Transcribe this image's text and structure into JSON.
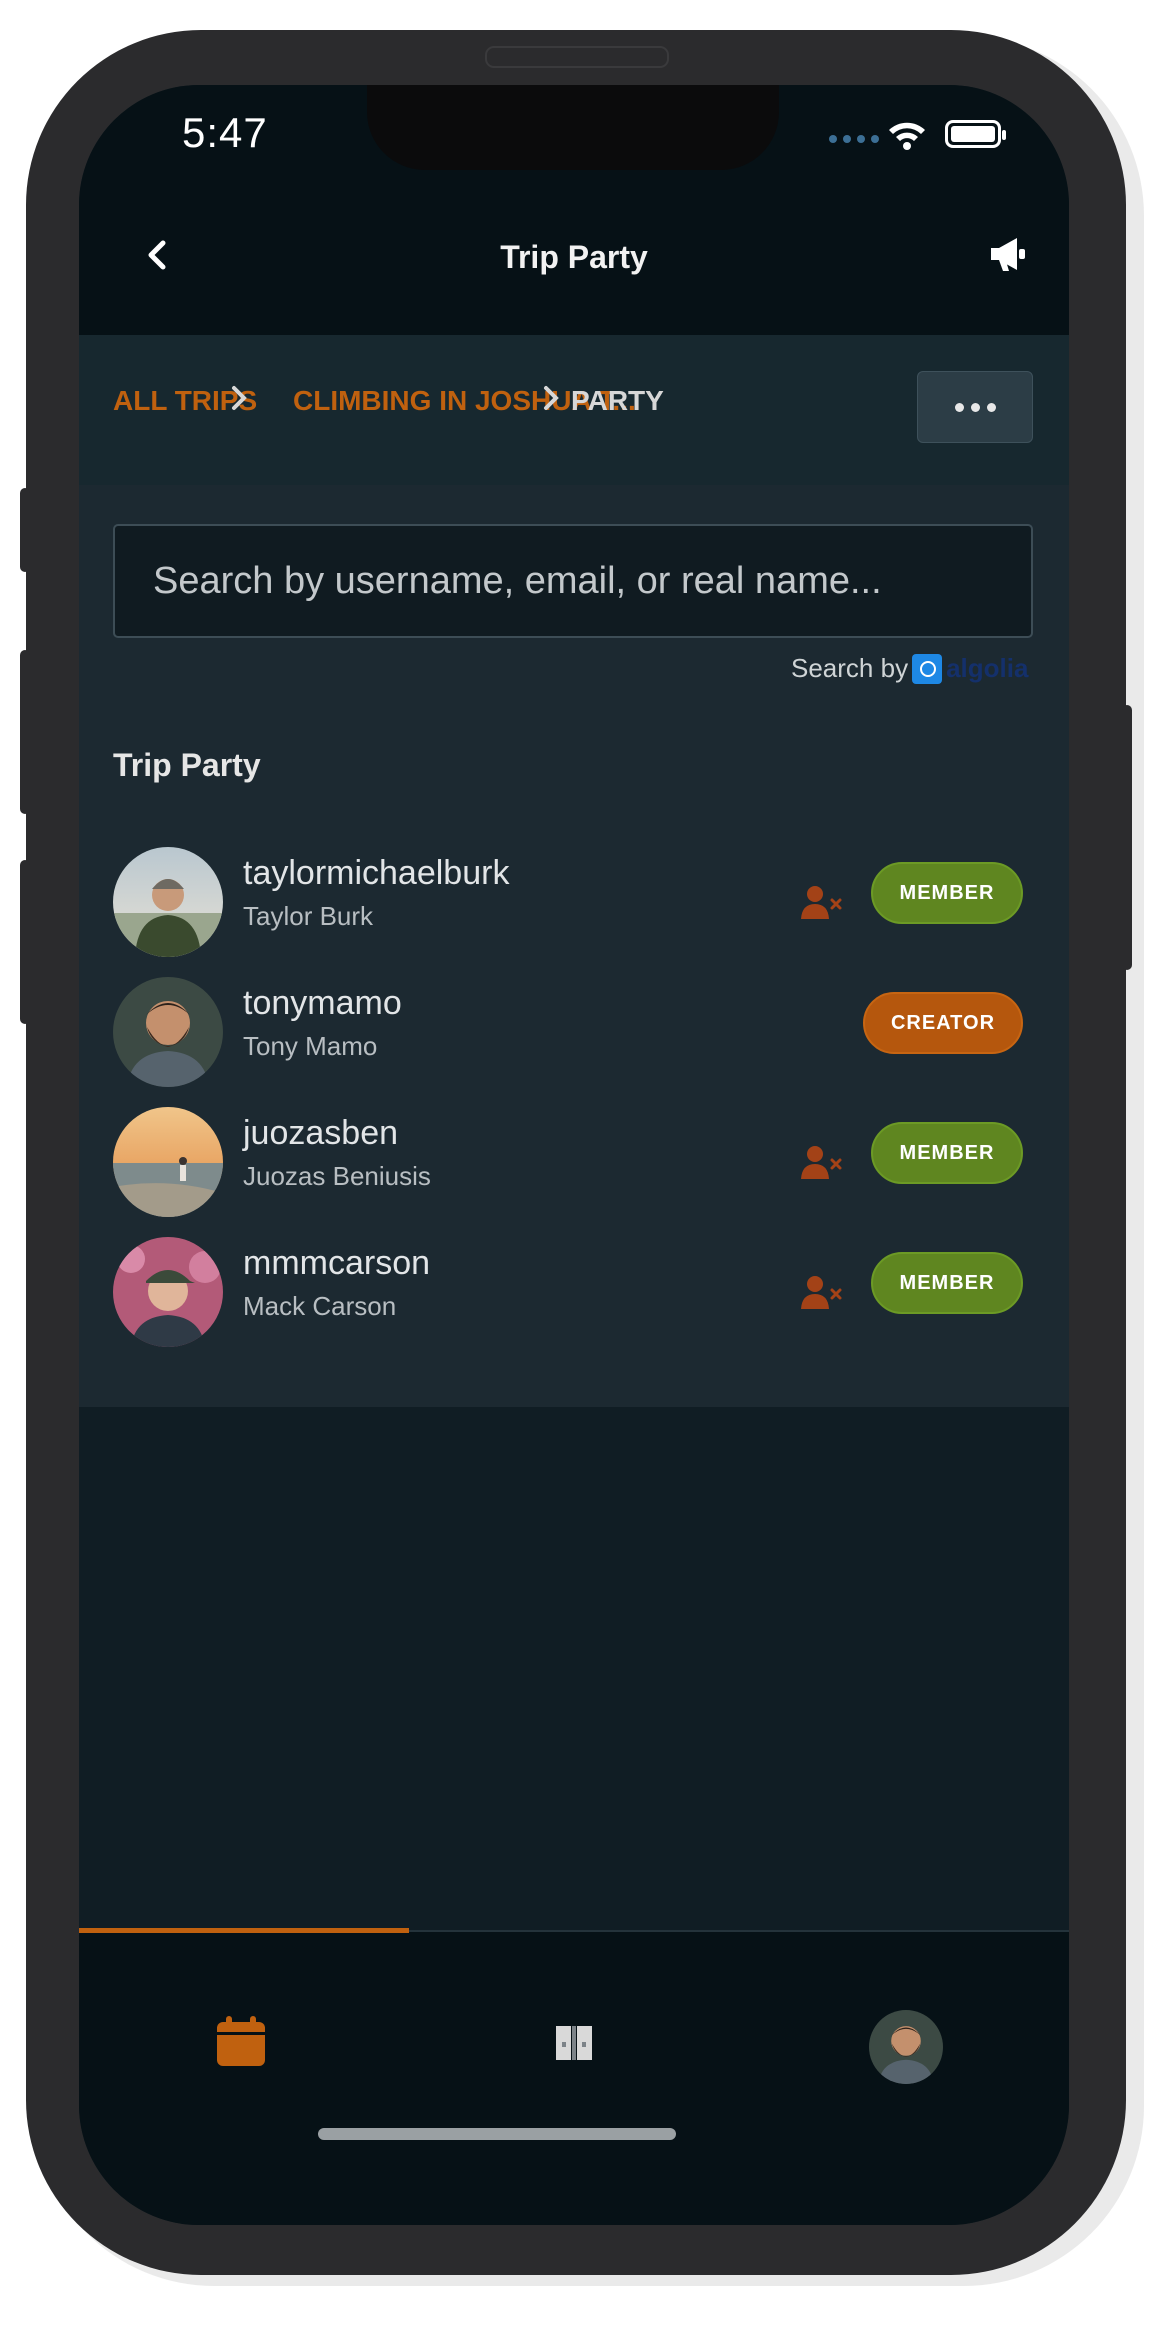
{
  "status_bar": {
    "time": "5:47"
  },
  "header": {
    "title": "Trip Party",
    "back_icon": "chevron-left-icon",
    "action_icon": "megaphone-icon"
  },
  "breadcrumb": {
    "items": [
      {
        "label": "ALL TRIPS"
      },
      {
        "label": "CLIMBING IN JOSHUA T..."
      },
      {
        "label": "PARTY"
      }
    ],
    "more_icon": "ellipsis-icon"
  },
  "search": {
    "placeholder": "Search by username, email, or real name...",
    "value": "",
    "powered_by": "Search by",
    "provider": "algolia"
  },
  "party": {
    "title": "Trip Party",
    "members": [
      {
        "username": "taylormichaelburk",
        "real_name": "Taylor Burk",
        "role": "MEMBER",
        "removable": true
      },
      {
        "username": "tonymamo",
        "real_name": "Tony Mamo",
        "role": "CREATOR",
        "removable": false
      },
      {
        "username": "juozasben",
        "real_name": "Juozas Beniusis",
        "role": "MEMBER",
        "removable": true
      },
      {
        "username": "mmmcarson",
        "real_name": "Mack Carson",
        "role": "MEMBER",
        "removable": true
      }
    ]
  },
  "tab_bar": {
    "tabs": [
      {
        "icon": "calendar-icon",
        "active": true
      },
      {
        "icon": "map-book-icon",
        "active": false
      },
      {
        "icon": "profile-avatar",
        "active": false
      }
    ]
  },
  "colors": {
    "accent": "#c0610f",
    "member_badge": "#5f8620",
    "creator_badge": "#b5570d",
    "background": "#101d24",
    "panel": "#1c2931"
  }
}
